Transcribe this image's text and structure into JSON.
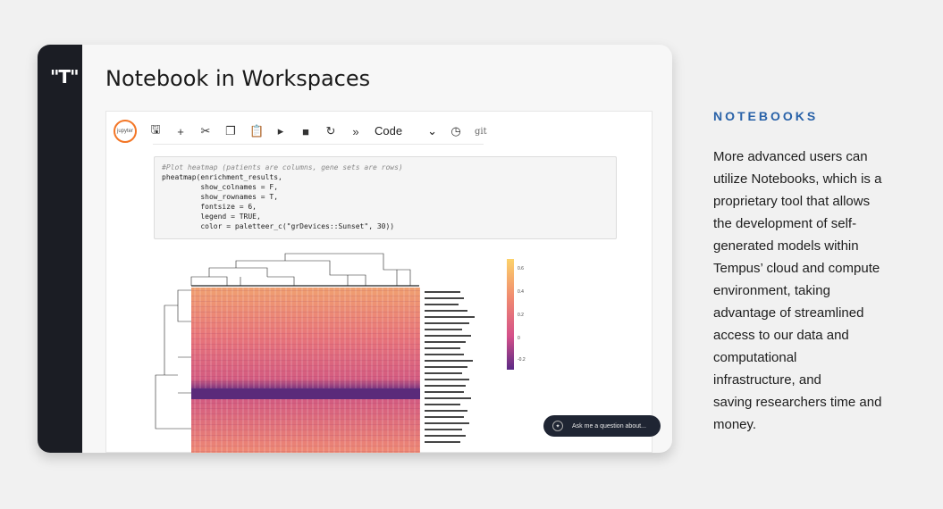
{
  "card": {
    "logo_text": "\"T\"",
    "title": "Notebook in Workspaces"
  },
  "notebook": {
    "toolbar": {
      "jupyter_label": "jupyter",
      "icons": [
        "save-icon",
        "plus-icon",
        "cut-icon",
        "copy-icon",
        "paste-icon",
        "run-icon",
        "stop-icon",
        "restart-icon",
        "fast-forward-icon"
      ],
      "cell_type": "Code",
      "git_label": "git"
    },
    "code_lines": [
      "#Plot heatmap (patients are columns, gene sets are rows)",
      "pheatmap(enrichment_results,",
      "         show_colnames = F,",
      "         show_rownames = T,",
      "         fontsize = 6,",
      "         legend = TRUE,",
      "         color = paletteer_c(\"grDevices::Sunset\", 30))"
    ],
    "heatmap": {
      "legend_ticks": [
        "0.6",
        "0.4",
        "0.2",
        "0",
        "-0.2"
      ]
    }
  },
  "chat": {
    "placeholder": "Ask me a question about..."
  },
  "sidebar_text": {
    "heading": "NOTEBOOKS",
    "lines": [
      "More advanced users can",
      "utilize Notebooks, which is a",
      "proprietary tool that allows",
      "the development of self-",
      "generated models within",
      "Tempus’ cloud and compute",
      "environment, taking",
      "advantage of streamlined",
      "access to our data and",
      "computational",
      "infrastructure, and",
      "saving researchers time and",
      "money."
    ]
  }
}
